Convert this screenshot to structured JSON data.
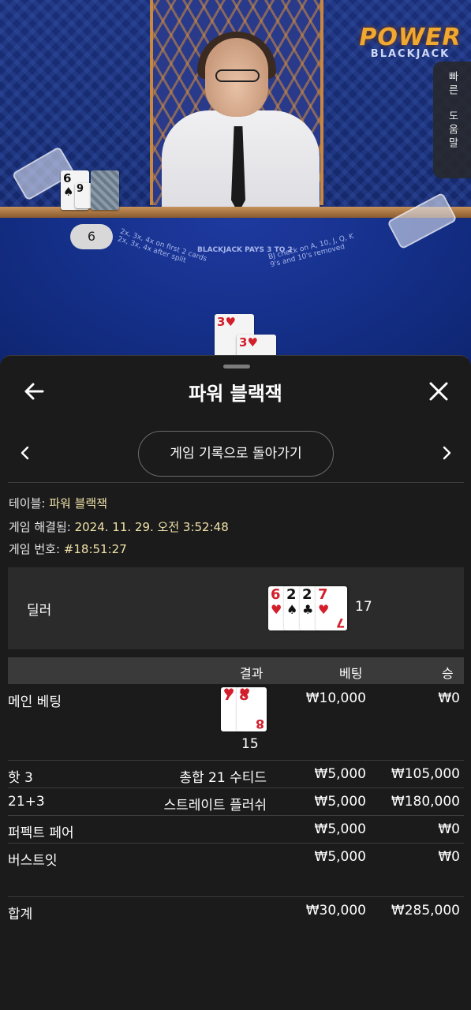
{
  "video": {
    "logo_line1": "POWER",
    "logo_line2": "BLACKJACK",
    "side_help_top": "빠른",
    "side_help_bottom": "도움말",
    "dealer_hand_cards": [
      {
        "rank": "6",
        "suit": "♠"
      },
      {
        "rank": "9",
        "suit": "♠"
      }
    ],
    "dealer_score_bubble": "6",
    "felt_left": "2x, 3x, 4x on first 2 cards\n2x, 3x, 4x after split",
    "felt_center": "BLACKJACK PAYS 3 TO 2",
    "felt_right": "BJ check on A, 10, J, Q, K\n9's and 10's removed",
    "player_cards": [
      {
        "rank": "3",
        "suit": "♥"
      },
      {
        "rank": "3",
        "suit": "♥"
      }
    ]
  },
  "sheet": {
    "title": "파워 블랙잭",
    "history_button": "게임 기록으로 돌아가기",
    "info": [
      {
        "label": "테이블: ",
        "value": "파워 블랙잭"
      },
      {
        "label": "게임 해결됨: ",
        "value": "2024. 11. 29. 오전 3:52:48"
      },
      {
        "label": "게임 번호: ",
        "value": "#18:51:27"
      }
    ],
    "dealer": {
      "label": "딜러",
      "cards": [
        {
          "rank": "6",
          "suit": "♥",
          "color": "#d21f2b"
        },
        {
          "rank": "2",
          "suit": "♠",
          "color": "#111111"
        },
        {
          "rank": "2",
          "suit": "♣",
          "color": "#111111"
        },
        {
          "rank": "7",
          "suit": "♥",
          "color": "#d21f2b"
        }
      ],
      "total": "17"
    },
    "table_headers": {
      "result": "결과",
      "bet": "베팅",
      "win": "승"
    },
    "rows": [
      {
        "name": "메인 베팅",
        "cards": [
          {
            "rank": "7",
            "suit": "♥"
          },
          {
            "rank": "8",
            "suit": "♥"
          }
        ],
        "hand_total": "15",
        "result": "",
        "bet": "₩10,000",
        "win": "₩0"
      },
      {
        "name": "핫 3",
        "result": "총합 21 수티드",
        "bet": "₩5,000",
        "win": "₩105,000"
      },
      {
        "name": "21+3",
        "result": "스트레이트 플러쉬",
        "bet": "₩5,000",
        "win": "₩180,000"
      },
      {
        "name": "퍼펙트 페어",
        "result": "",
        "bet": "₩5,000",
        "win": "₩0"
      },
      {
        "name": "버스트잇",
        "result": "",
        "bet": "₩5,000",
        "win": "₩0"
      }
    ],
    "total": {
      "label": "합계",
      "bet": "₩30,000",
      "win": "₩285,000"
    }
  },
  "colors": {
    "background": "#1b1b1b",
    "panel": "#2b2b2b",
    "header": "#3a3a3a",
    "info_value": "#f0e2a8",
    "card_red": "#d21f2b"
  }
}
